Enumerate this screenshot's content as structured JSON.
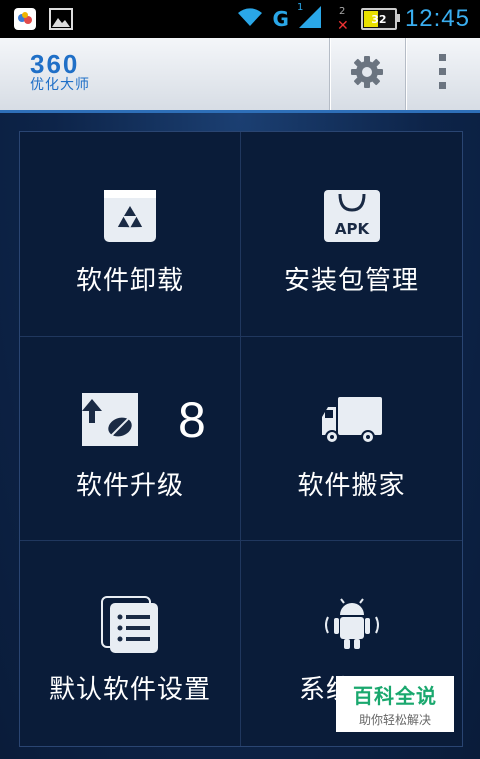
{
  "status_bar": {
    "network_type": "G",
    "signal_1_label": "1",
    "signal_2_label": "2",
    "battery_level": "32",
    "time": "12:45",
    "icons": [
      "app-icon",
      "image-icon",
      "wifi-icon",
      "signal-icon",
      "no-signal-icon",
      "battery-icon"
    ]
  },
  "app_bar": {
    "logo_number": "360",
    "logo_text": "优化大师",
    "icons": [
      "settings-gear-icon",
      "overflow-menu-icon"
    ]
  },
  "tiles": [
    {
      "label": "软件卸载",
      "icon": "recycle-bin-icon"
    },
    {
      "label": "安装包管理",
      "icon": "apk-bag-icon",
      "icon_text": "APK"
    },
    {
      "label": "软件升级",
      "icon": "upgrade-android-icon",
      "badge": "8"
    },
    {
      "label": "软件搬家",
      "icon": "truck-icon"
    },
    {
      "label": "默认软件设置",
      "icon": "list-document-icon"
    },
    {
      "label": "系统",
      "icon": "vibrating-android-icon"
    }
  ],
  "watermark": {
    "title": "百科全说",
    "subtitle": "助你轻松解决"
  },
  "colors": {
    "accent": "#2e6fb8",
    "logo_blue": "#1f6fc7",
    "background": "#0b1a33",
    "watermark_green": "#1aa86e"
  }
}
